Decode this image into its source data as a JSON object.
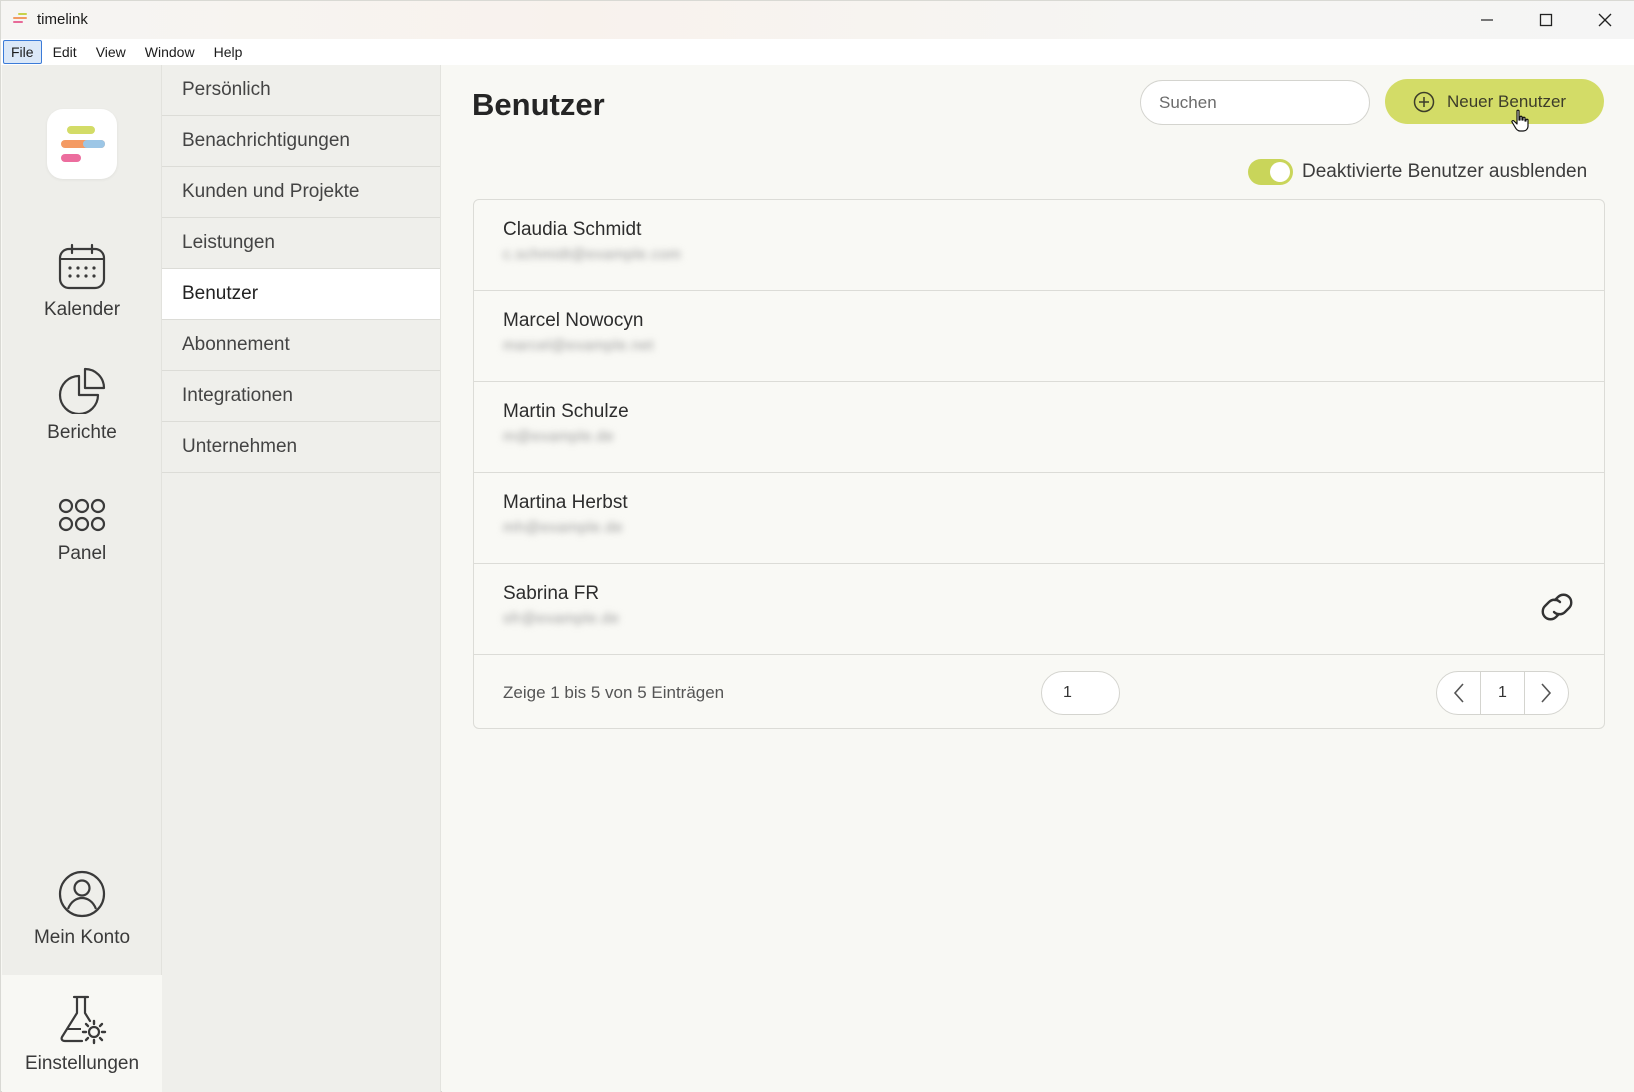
{
  "window": {
    "title": "timelink",
    "controls": [
      "minimize-icon",
      "maximize-icon",
      "close-icon"
    ]
  },
  "menubar": {
    "items": [
      "File",
      "Edit",
      "View",
      "Window",
      "Help"
    ],
    "active": "File"
  },
  "rail": {
    "items": [
      {
        "label": "Kalender",
        "icon": "calendar-icon"
      },
      {
        "label": "Berichte",
        "icon": "pie-chart-icon"
      },
      {
        "label": "Panel",
        "icon": "grid-dots-icon"
      },
      {
        "label": "Mein Konto",
        "icon": "user-circle-icon"
      },
      {
        "label": "Einstellungen",
        "icon": "flask-gear-icon"
      }
    ],
    "selected": "Einstellungen"
  },
  "subnav": {
    "items": [
      {
        "label": "Persönlich"
      },
      {
        "label": "Benachrichtigungen"
      },
      {
        "label": "Kunden und Projekte"
      },
      {
        "label": "Leistungen"
      },
      {
        "label": "Benutzer"
      },
      {
        "label": "Abonnement"
      },
      {
        "label": "Integrationen"
      },
      {
        "label": "Unternehmen"
      }
    ],
    "selected": "Benutzer"
  },
  "main": {
    "title": "Benutzer",
    "search_placeholder": "Suchen",
    "new_user_label": "Neuer Benutzer",
    "toggle_label": "Deaktivierte Benutzer ausblenden",
    "toggle_on": true,
    "users": [
      {
        "name": "Claudia Schmidt",
        "email": "c.schmidt@example.com",
        "link": false
      },
      {
        "name": "Marcel Nowocyn",
        "email": "marcel@example.net",
        "link": false
      },
      {
        "name": "Martin Schulze",
        "email": "m@example.de",
        "link": false
      },
      {
        "name": "Martina Herbst",
        "email": "mh@example.de",
        "link": false
      },
      {
        "name": "Sabrina FR",
        "email": "sfr@example.de",
        "link": true
      }
    ],
    "footer_text": "Zeige 1 bis 5 von 5 Einträgen",
    "page_size": "1",
    "current_page": "1"
  },
  "colors": {
    "accent": "#d3dc67",
    "toggle": "#c9d55a",
    "rail_bg": "#eeeeea",
    "subnav_bg": "#efefeb"
  }
}
